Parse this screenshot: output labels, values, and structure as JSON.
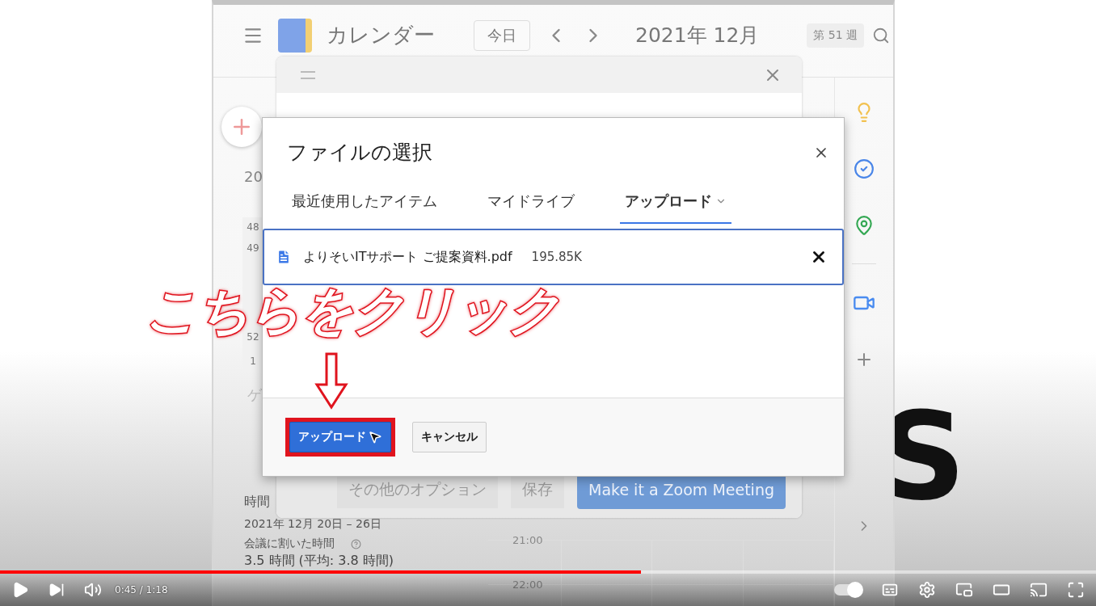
{
  "calendar": {
    "header": {
      "app_name": "カレンダー",
      "today_button": "今日",
      "month": "2021年 12月",
      "week_badge": "第 51 週"
    },
    "sidebar": {
      "year_partial": "20",
      "week_numbers": [
        "48",
        "49",
        "52",
        "1"
      ],
      "section_partial": "ゲ"
    },
    "stats": {
      "heading": "時間",
      "range": "2021年 12月 20日 – 26日",
      "meeting_label": "会議に割いた時間",
      "meeting_value": "3.5 時間 (平均: 3.8 時間)"
    },
    "time_labels": [
      "21:00",
      "22:00"
    ]
  },
  "event_dialog": {
    "more_options": "その他のオプション",
    "save": "保存",
    "zoom_button": "Make it a Zoom Meeting"
  },
  "file_picker": {
    "title": "ファイルの選択",
    "tabs": [
      {
        "label": "最近使用したアイテム",
        "selected": false,
        "dropdown": false
      },
      {
        "label": "マイドライブ",
        "selected": false,
        "dropdown": false
      },
      {
        "label": "アップロード",
        "selected": true,
        "dropdown": true
      }
    ],
    "files": [
      {
        "name": "よりそいITサポート ご提案資料.pdf",
        "size": "195.85K"
      }
    ],
    "buttons": [
      {
        "label": "アップロード",
        "kind": "primary",
        "highlighted": true
      },
      {
        "label": "キャンセル",
        "kind": "secondary",
        "highlighted": false
      }
    ]
  },
  "annotation": {
    "text": "こちらをクリック"
  },
  "background_sign": {
    "text": "S"
  },
  "player": {
    "time": "0:45 / 1:18",
    "progress": {
      "level": 0.585
    },
    "autoplay": {
      "on": true
    }
  }
}
